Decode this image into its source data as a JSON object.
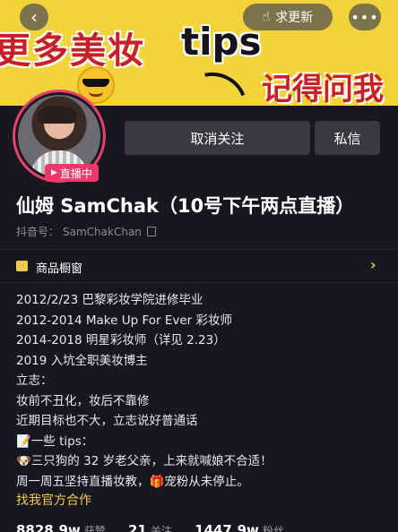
{
  "banner": {
    "text_left": "更多美妆",
    "text_tips": "tips",
    "text_right": "记得问我"
  },
  "nav": {
    "back": "‹",
    "update_label": "求更新",
    "more": "•••"
  },
  "profile": {
    "live_badge": "直播中",
    "unfollow_label": "取消关注",
    "message_label": "私信",
    "name": "仙姆 SamChak（10号下午两点直播）",
    "douyin_id_label": "抖音号：",
    "douyin_id": "SamChakChan"
  },
  "shop": {
    "label": "商品橱窗",
    "arrow": "›"
  },
  "bio": {
    "lines": [
      "2012/2/23 巴黎彩妆学院进修毕业",
      "2012-2014 Make Up For Ever 彩妆师",
      "2014-2018 明星彩妆师（详见 2.23）",
      "2019 入坑全职美妆博主",
      "立志：",
      "妆前不丑化，妆后不靠修",
      "近期目标也不大，立志说好普通话",
      "📝一些 tips：",
      "🐶三只狗的 32 岁老父亲，上来就喊娘不合适！",
      "周一周五坚持直播妆教，🎁宠粉从未停止。"
    ],
    "business_link": "找我官方合作"
  },
  "stats": {
    "likes_value": "8828.9w",
    "likes_label": "获赞",
    "following_value": "21",
    "following_label": "关注",
    "followers_value": "1447.9w",
    "followers_label": "粉丝"
  },
  "colors": {
    "banner_bg": "#f3d33a",
    "accent_pink": "#f0396a",
    "link_gold": "#f2c94c",
    "page_bg": "#17171f"
  }
}
